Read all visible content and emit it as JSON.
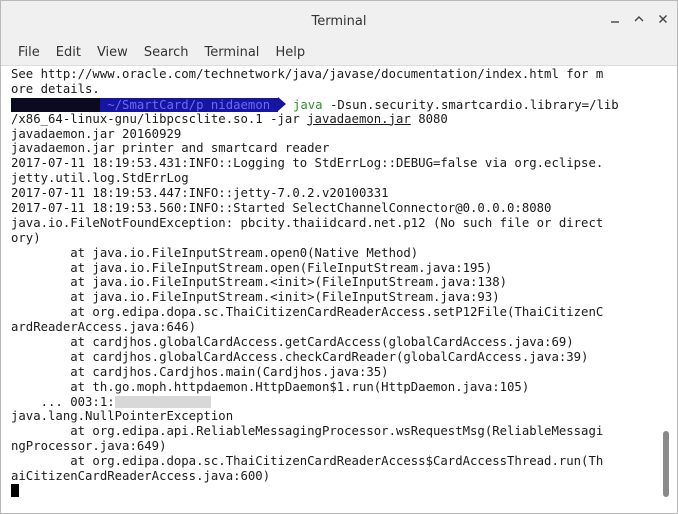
{
  "window": {
    "title": "Terminal"
  },
  "menu": [
    "File",
    "Edit",
    "View",
    "Search",
    "Terminal",
    "Help"
  ],
  "terminal": {
    "lines_before_prompt": [
      "See http://www.oracle.com/technetwork/java/javase/documentation/index.html for m",
      "ore details."
    ],
    "prompt": {
      "user_host_redacted": "            ",
      "path": " ~/SmartCard/p nidaemon ",
      "command": "java",
      "args": " -Dsun.security.smartcardio.library=/lib",
      "continuation_prefix": "/x86_64-linux-gnu/libpcsclite.so.1 -jar ",
      "jar": "javadaemon.jar",
      "port": " 8080"
    },
    "output_lines": [
      "javadaemon.jar 20160929",
      "javadaemon.jar printer and smartcard reader",
      "2017-07-11 18:19:53.431:INFO::Logging to StdErrLog::DEBUG=false via org.eclipse.",
      "jetty.util.log.StdErrLog",
      "2017-07-11 18:19:53.447:INFO::jetty-7.0.2.v20100331",
      "2017-07-11 18:19:53.560:INFO::Started SelectChannelConnector@0.0.0.0:8080",
      "java.io.FileNotFoundException: pbcity.thaiidcard.net.p12 (No such file or direct",
      "ory)",
      "        at java.io.FileInputStream.open0(Native Method)",
      "        at java.io.FileInputStream.open(FileInputStream.java:195)",
      "        at java.io.FileInputStream.<init>(FileInputStream.java:138)",
      "        at java.io.FileInputStream.<init>(FileInputStream.java:93)",
      "        at org.edipa.dopa.sc.ThaiCitizenCardReaderAccess.setP12File(ThaiCitizenC",
      "ardReaderAccess.java:646)",
      "        at cardjhos.globalCardAccess.getCardAccess(globalCardAccess.java:69)",
      "        at cardjhos.globalCardAccess.checkCardReader(globalCardAccess.java:39)",
      "        at cardjhos.Cardjhos.main(Cardjhos.java:35)",
      "        at th.go.moph.httpdaemon.HttpDaemon$1.run(HttpDaemon.java:105)"
    ],
    "redacted_line_prefix": "    ... 003:1:",
    "redacted_line_blur": "             ",
    "output_lines_after": [
      "java.lang.NullPointerException",
      "        at org.edipa.api.ReliableMessagingProcessor.wsRequestMsg(ReliableMessagi",
      "ngProcessor.java:649)",
      "        at org.edipa.dopa.sc.ThaiCitizenCardReaderAccess$CardAccessThread.run(Th",
      "aiCitizenCardReaderAccess.java:600)"
    ]
  }
}
